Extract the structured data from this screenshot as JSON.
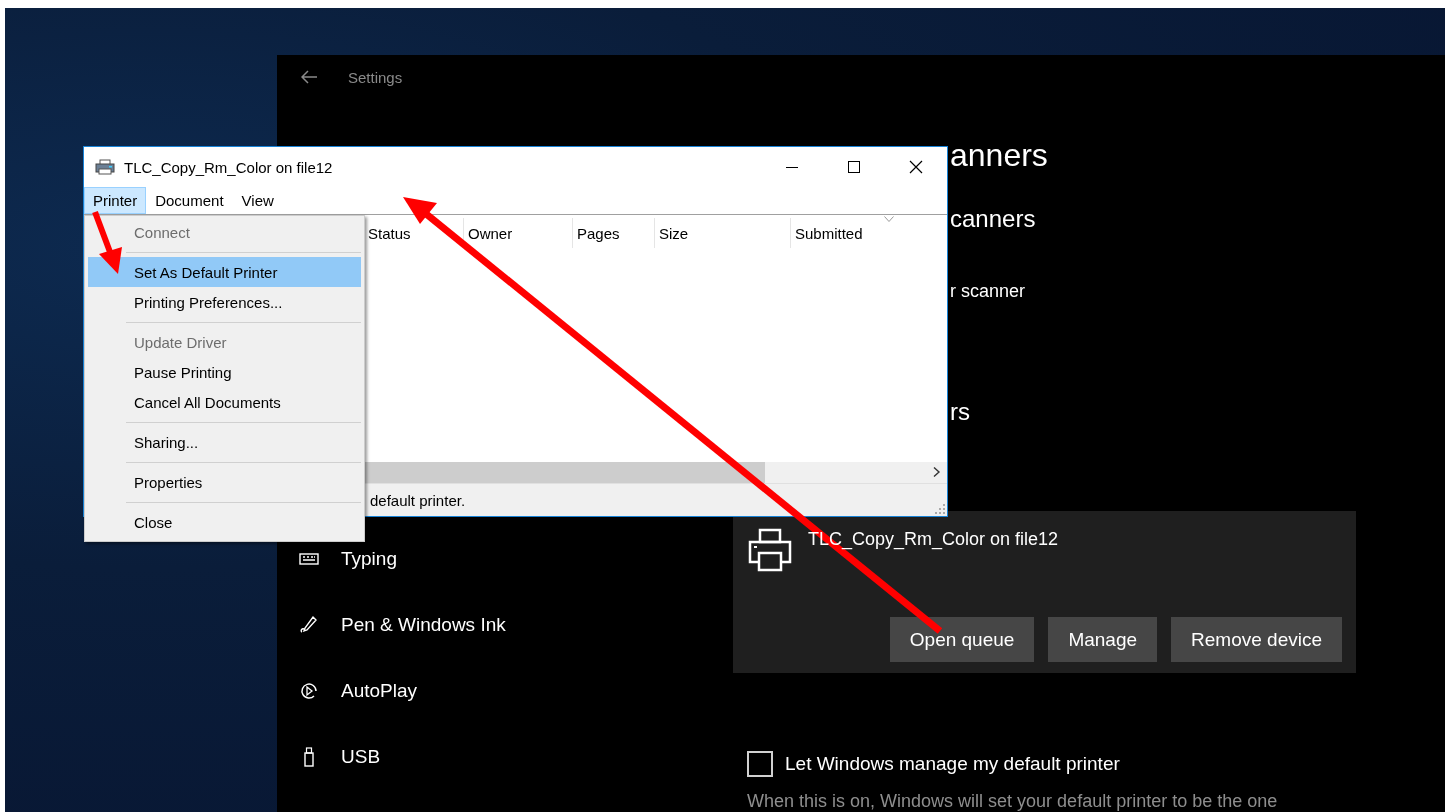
{
  "settings_window": {
    "title": "Settings",
    "sidebar": {
      "items": [
        {
          "label": "Typing"
        },
        {
          "label": "Pen & Windows Ink"
        },
        {
          "label": "AutoPlay"
        },
        {
          "label": "USB"
        }
      ]
    },
    "main": {
      "heading": "anners",
      "subheading": "canners",
      "add_device_link": "r scanner",
      "subheading_2": "rs",
      "printer_card": {
        "name": "TLC_Copy_Rm_Color on file12",
        "buttons": [
          "Open queue",
          "Manage",
          "Remove device"
        ]
      },
      "default_printer_option": {
        "label": "Let Windows manage my default printer",
        "checked": false
      },
      "description": "When this is on, Windows will set your default printer to be the one"
    }
  },
  "queue_window": {
    "title": "TLC_Copy_Rm_Color on file12",
    "menu_bar": [
      {
        "label": "Printer",
        "selected": true
      },
      {
        "label": "Document",
        "selected": false
      },
      {
        "label": "View",
        "selected": false
      }
    ],
    "columns": [
      "Status",
      "Owner",
      "Pages",
      "Size",
      "Submitted"
    ],
    "status_bar": "default printer.",
    "menu": {
      "items": [
        {
          "kind": "item",
          "label": "Connect",
          "disabled": true,
          "selected": false
        },
        {
          "kind": "separator"
        },
        {
          "kind": "item",
          "label": "Set As Default Printer",
          "disabled": false,
          "selected": true
        },
        {
          "kind": "item",
          "label": "Printing Preferences...",
          "disabled": false,
          "selected": false
        },
        {
          "kind": "separator"
        },
        {
          "kind": "item",
          "label": "Update Driver",
          "disabled": true,
          "selected": false
        },
        {
          "kind": "item",
          "label": "Pause Printing",
          "disabled": false,
          "selected": false
        },
        {
          "kind": "item",
          "label": "Cancel All Documents",
          "disabled": false,
          "selected": false
        },
        {
          "kind": "separator"
        },
        {
          "kind": "item",
          "label": "Sharing...",
          "disabled": false,
          "selected": false
        },
        {
          "kind": "separator"
        },
        {
          "kind": "item",
          "label": "Properties",
          "disabled": false,
          "selected": false
        },
        {
          "kind": "separator"
        },
        {
          "kind": "item",
          "label": "Close",
          "disabled": false,
          "selected": false
        }
      ]
    }
  }
}
